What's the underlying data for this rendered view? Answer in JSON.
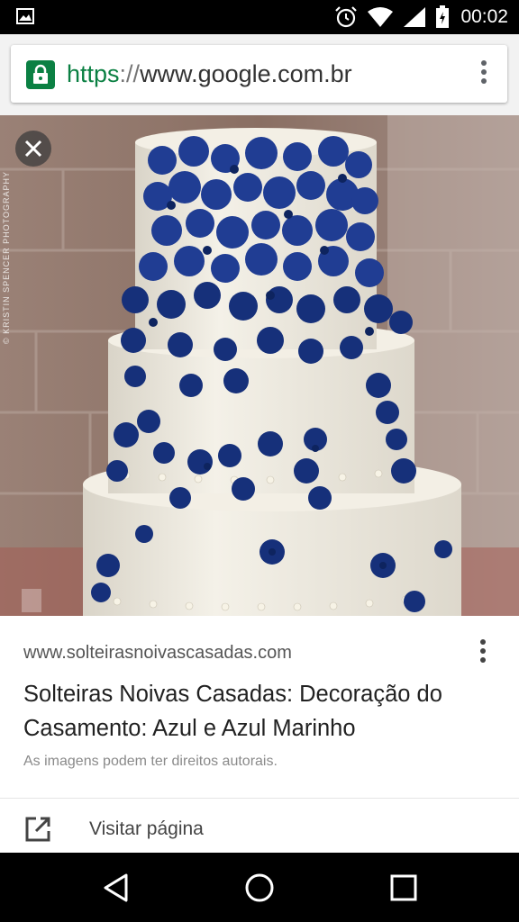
{
  "status_bar": {
    "time": "00:02",
    "icons": [
      "gallery-icon",
      "alarm-icon",
      "wifi-icon",
      "signal-icon",
      "battery-icon"
    ]
  },
  "browser": {
    "url_scheme": "https",
    "url_separator": "://",
    "url_host": "www.google.com.br",
    "secure_color": "#0b8043",
    "menu_icon": "more-vert-icon"
  },
  "image_viewer": {
    "watermark": "© KRISTIN SPENCER PHOTOGRAPHY",
    "close_icon": "close-icon",
    "colors": {
      "flowers": "#1c3a8c",
      "frosting": "#f1ede2",
      "brick": "#8a6f63"
    }
  },
  "result": {
    "source": "www.solteirasnoivascasadas.com",
    "title": "Solteiras Noivas Casadas: Decoração do Casamento: Azul e Azul Marinho",
    "rights_notice": "As imagens podem ter direitos autorais.",
    "visit_label": "Visitar página",
    "visit_icon": "open-in-new-icon"
  },
  "nav_bar": {
    "buttons": [
      "back-icon",
      "home-icon",
      "recents-icon"
    ]
  }
}
